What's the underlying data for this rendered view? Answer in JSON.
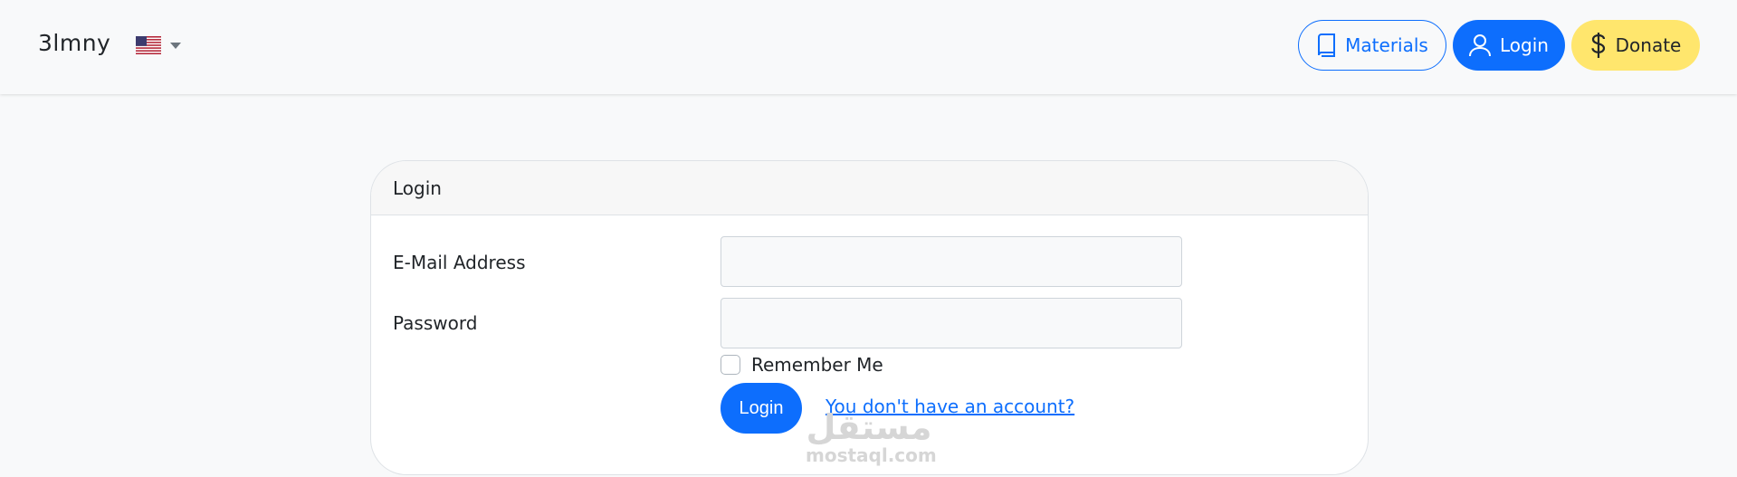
{
  "navbar": {
    "brand": "3lmny",
    "language": {
      "selected": "en-US",
      "flag_icon": "us-flag-icon"
    },
    "buttons": {
      "materials_label": "Materials",
      "login_label": "Login",
      "donate_label": "Donate"
    }
  },
  "login_card": {
    "title": "Login",
    "email_label": "E-Mail Address",
    "email_value": "",
    "password_label": "Password",
    "password_value": "",
    "remember_label": "Remember Me",
    "remember_checked": false,
    "submit_label": "Login",
    "register_link": "You don't have an account?"
  },
  "watermark": {
    "arabic": "مستقل",
    "latin": "mostaql.com"
  },
  "colors": {
    "primary": "#0d6efd",
    "donate": "#ffe66d",
    "background": "#f8f9fa",
    "card_header": "#f7f7f7"
  }
}
